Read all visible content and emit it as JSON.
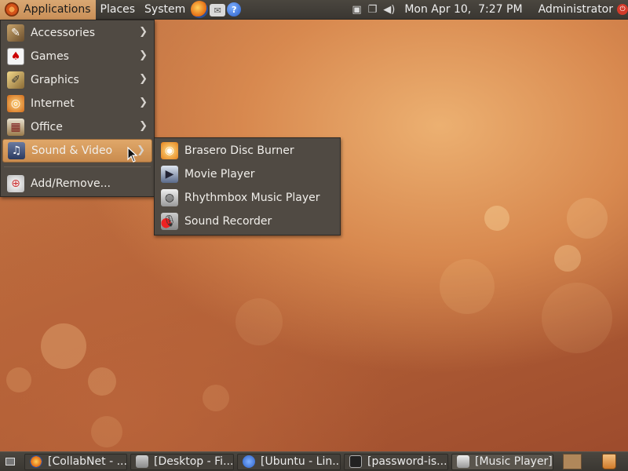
{
  "top_panel": {
    "menus": [
      "Applications",
      "Places",
      "System"
    ],
    "launchers": [
      "firefox-icon",
      "mail-icon",
      "help-icon"
    ],
    "help_glyph": "?",
    "clock": "Mon Apr 10,  7:27 PM",
    "user": "Administrator"
  },
  "applications_menu": {
    "items": [
      {
        "label": "Accessories",
        "icon": "accessories-icon",
        "submenu": true
      },
      {
        "label": "Games",
        "icon": "games-icon",
        "submenu": true
      },
      {
        "label": "Graphics",
        "icon": "graphics-icon",
        "submenu": true
      },
      {
        "label": "Internet",
        "icon": "internet-icon",
        "submenu": true
      },
      {
        "label": "Office",
        "icon": "office-icon",
        "submenu": true
      },
      {
        "label": "Sound & Video",
        "icon": "sound-video-icon",
        "submenu": true,
        "highlighted": true
      }
    ],
    "footer_item": {
      "label": "Add/Remove...",
      "icon": "add-remove-icon"
    }
  },
  "sound_video_menu": {
    "items": [
      {
        "label": "Brasero Disc Burner",
        "icon": "brasero-icon"
      },
      {
        "label": "Movie Player",
        "icon": "movie-player-icon"
      },
      {
        "label": "Rhythmbox Music Player",
        "icon": "rhythmbox-icon"
      },
      {
        "label": "Sound Recorder",
        "icon": "sound-recorder-icon"
      }
    ]
  },
  "taskbar": {
    "tasks": [
      {
        "label": "[CollabNet - ...",
        "icon": "firefox-icon"
      },
      {
        "label": "[Desktop - Fi...",
        "icon": "folder-icon"
      },
      {
        "label": "[Ubuntu - Lin...",
        "icon": "help-icon"
      },
      {
        "label": "[password-is...",
        "icon": "terminal-icon"
      },
      {
        "label": "[Music Player]",
        "icon": "music-player-icon"
      }
    ]
  },
  "colors": {
    "panel": "#3f3b36",
    "menu_bg": "#504a43",
    "highlight": "#d49a5c",
    "wallpaper": "#c77a48"
  }
}
